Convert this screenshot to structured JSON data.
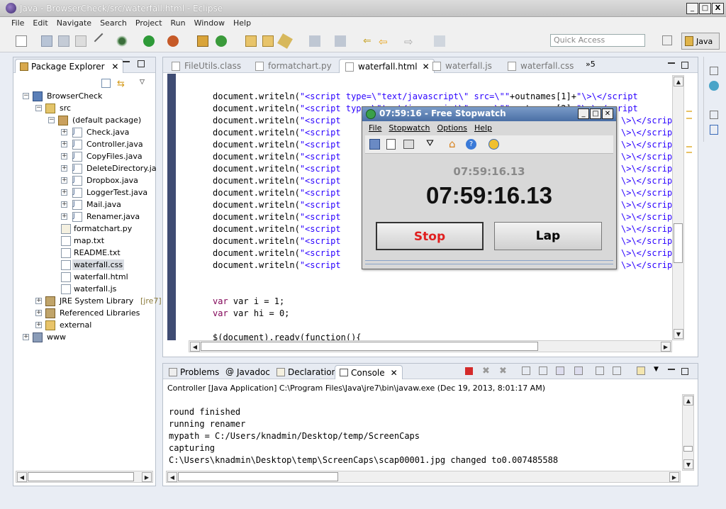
{
  "window": {
    "title": "Java - BrowserCheck/src/waterfall.html - Eclipse",
    "min": "_",
    "max": "□",
    "close": "X"
  },
  "menu": [
    "File",
    "Edit",
    "Navigate",
    "Search",
    "Project",
    "Run",
    "Window",
    "Help"
  ],
  "quick_access": {
    "placeholder": "Quick Access"
  },
  "perspective": {
    "label": "Java"
  },
  "package_explorer": {
    "title": "Package Explorer",
    "tree": [
      {
        "label": "BrowserCheck"
      },
      {
        "label": "src"
      },
      {
        "label": "(default package)"
      },
      {
        "label": "Check.java"
      },
      {
        "label": "Controller.java"
      },
      {
        "label": "CopyFiles.java"
      },
      {
        "label": "DeleteDirectory.ja"
      },
      {
        "label": "Dropbox.java"
      },
      {
        "label": "LoggerTest.java"
      },
      {
        "label": "Mail.java"
      },
      {
        "label": "Renamer.java"
      },
      {
        "label": "formatchart.py"
      },
      {
        "label": "map.txt"
      },
      {
        "label": "README.txt"
      },
      {
        "label": "waterfall.css"
      },
      {
        "label": "waterfall.html"
      },
      {
        "label": "waterfall.js"
      },
      {
        "label": "JRE System Library",
        "extra": "[jre7]"
      },
      {
        "label": "Referenced Libraries"
      },
      {
        "label": "external"
      },
      {
        "label": "www"
      }
    ]
  },
  "editor": {
    "tabs": [
      "FileUtils.class",
      "formatchart.py",
      "waterfall.html",
      "waterfall.js",
      "waterfall.css"
    ],
    "overflow": "»5",
    "line1": {
      "prefix": "document.writeln(",
      "str": "\"<script type=\\\"text/javascript\\\" src=\\\"\"",
      "rest": "+outnames[1]+",
      "str2": "\"\\>\\</script"
    },
    "line2": {
      "prefix": "document.writeln(",
      "str": "\"<script type=\\\"text/javascript\\\" src=\\\"\"",
      "rest": "+outnames[2]+",
      "str2": "\"\\>\\</script"
    },
    "line_left": "document.writeln(",
    "line_left_str": "\"<script",
    "line_right": "\\>\\</script",
    "line_right_alt": "\\>\\</scrip",
    "var_i": "var i = 1;",
    "var_hi": "var hi = 0;",
    "ready": "$(document).ready(function(){"
  },
  "console": {
    "tabs": [
      "Problems",
      "Javadoc",
      "Declaration",
      "Console"
    ],
    "header": "Controller [Java Application] C:\\Program Files\\Java\\jre7\\bin\\javaw.exe (Dec 19, 2013, 8:01:17 AM)",
    "lines": [
      "round finished",
      "running renamer",
      "mypath = C:/Users/knadmin/Desktop/temp/ScreenCaps",
      "capturing",
      "C:\\Users\\knadmin\\Desktop\\temp\\ScreenCaps\\scap00001.jpg changed to0.007485588"
    ]
  },
  "stopwatch": {
    "title": "07:59:16 - Free Stopwatch",
    "menu": [
      "File",
      "Stopwatch",
      "Options",
      "Help"
    ],
    "small_time": "07:59:16.13",
    "big_time": "07:59:16.13",
    "stop_label": "Stop",
    "lap_label": "Lap"
  }
}
